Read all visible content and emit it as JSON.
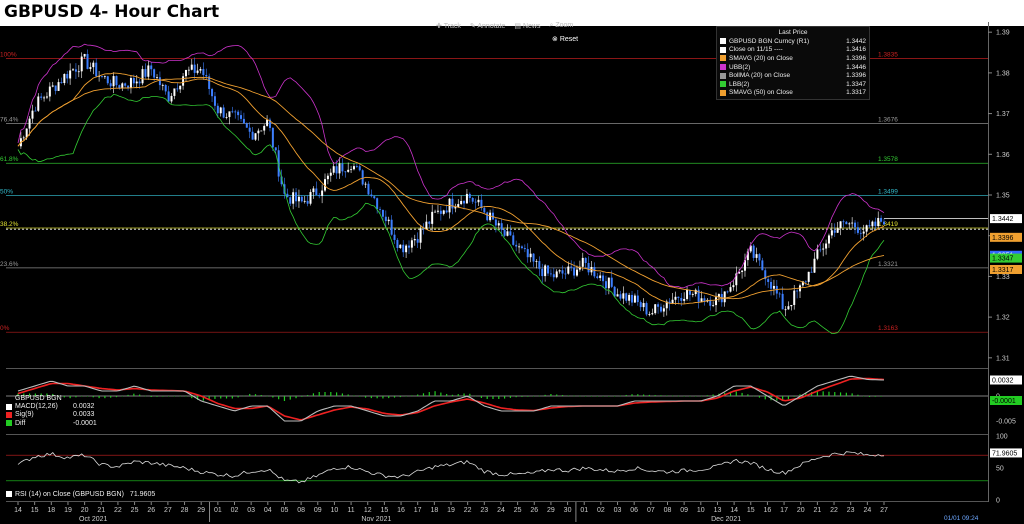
{
  "title": "GBPUSD 4- Hour Chart",
  "toolbar": {
    "track": "Track",
    "annotate": "Annotate",
    "news": "News",
    "zoom": "Zoom",
    "reset": "Reset"
  },
  "legend": {
    "header": "Last Price",
    "items": [
      {
        "label": "GBPUSD BGN Curncy  (R1)",
        "value": "1.3442",
        "color": "#ffffff"
      },
      {
        "label": "Close on 11/15  ----",
        "value": "1.3416",
        "color": "#ffffff"
      },
      {
        "label": "SMAVG (20)  on Close",
        "value": "1.3396",
        "color": "#f0a030"
      },
      {
        "label": "UBB(2)",
        "value": "1.3446",
        "color": "#cc33cc"
      },
      {
        "label": "BollMA (20)  on Close",
        "value": "1.3396",
        "color": "#999999"
      },
      {
        "label": "LBB(2)",
        "value": "1.3347",
        "color": "#33cc33"
      },
      {
        "label": "SMAVG (50)  on Close",
        "value": "1.3317",
        "color": "#f0a030"
      }
    ]
  },
  "macd_legend": {
    "title": "GBPUSD BGN",
    "items": [
      {
        "label": "MACD(12,26)",
        "value": "0.0032",
        "color": "#ffffff"
      },
      {
        "label": "Sig(9)",
        "value": "0.0033",
        "color": "#ee2222"
      },
      {
        "label": "Diff",
        "value": "-0.0001",
        "color": "#22cc22"
      }
    ]
  },
  "rsi_legend": {
    "label": "RSI (14)  on Close (GBPUSD BGN)",
    "value": "71.9605",
    "color": "#ffffff"
  },
  "timestamp": "01/01 09:24",
  "chart_data": [
    {
      "type": "candlestick",
      "title": "GBPUSD 4- Hour Chart",
      "y_ticks": [
        "1.39",
        "1.38",
        "1.37",
        "1.36",
        "1.35",
        "1.34",
        "1.33",
        "1.32",
        "1.31"
      ],
      "ylim": [
        1.3075,
        1.3925
      ],
      "x_tick_labels": [
        "14",
        "15",
        "18",
        "19",
        "20",
        "21",
        "22",
        "25",
        "26",
        "27",
        "28",
        "29",
        "01",
        "02",
        "03",
        "04",
        "05",
        "08",
        "09",
        "10",
        "11",
        "12",
        "15",
        "16",
        "17",
        "18",
        "19",
        "22",
        "23",
        "24",
        "25",
        "26",
        "29",
        "30",
        "01",
        "02",
        "03",
        "06",
        "07",
        "08",
        "09",
        "10",
        "13",
        "14",
        "15",
        "16",
        "17",
        "20",
        "21",
        "22",
        "23",
        "24",
        "27"
      ],
      "month_labels": [
        {
          "label": "Oct 2021",
          "index": 5
        },
        {
          "label": "Nov 2021",
          "index": 22
        },
        {
          "label": "Dec 2021",
          "index": 43
        }
      ],
      "fib_levels": [
        {
          "value": 1.3835,
          "left": "100%",
          "right": "1.3835",
          "color": "#cc2222"
        },
        {
          "value": 1.3676,
          "left": "76.4%",
          "right": "1.3676",
          "color": "#999999"
        },
        {
          "value": 1.3578,
          "left": "61.8%",
          "right": "1.3578",
          "color": "#33cc33"
        },
        {
          "value": 1.3499,
          "left": "50%",
          "right": "1.3499",
          "color": "#33bbcc"
        },
        {
          "value": 1.3419,
          "left": "38.2%",
          "right": "1.3419",
          "color": "#e0e030"
        },
        {
          "value": 1.3321,
          "left": "23.6%",
          "right": "1.3321",
          "color": "#999999"
        },
        {
          "value": 1.3163,
          "left": "0%",
          "right": "1.3163",
          "color": "#cc2222"
        }
      ],
      "close_line": 1.3416,
      "price_tags": [
        {
          "value": "1.3442",
          "y": 1.3442,
          "bg": "#ffffff",
          "fg": "#000000"
        },
        {
          "value": "1.3396",
          "y": 1.3396,
          "bg": "#f0a030",
          "fg": "#000000"
        },
        {
          "value": "1.3351",
          "y": 1.3352,
          "bg": "#3366ff",
          "fg": "#ffffff"
        },
        {
          "value": "1.3347",
          "y": 1.3345,
          "bg": "#33cc33",
          "fg": "#000000"
        },
        {
          "value": "1.3317",
          "y": 1.3317,
          "bg": "#f0a030",
          "fg": "#000000"
        }
      ],
      "close_path": [
        1.362,
        1.372,
        1.376,
        1.38,
        1.383,
        1.379,
        1.377,
        1.378,
        1.381,
        1.374,
        1.38,
        1.381,
        1.371,
        1.369,
        1.365,
        1.368,
        1.35,
        1.348,
        1.351,
        1.356,
        1.358,
        1.352,
        1.345,
        1.337,
        1.34,
        1.345,
        1.348,
        1.35,
        1.346,
        1.341,
        1.337,
        1.333,
        1.33,
        1.331,
        1.333,
        1.33,
        1.326,
        1.324,
        1.321,
        1.324,
        1.326,
        1.325,
        1.324,
        1.329,
        1.336,
        1.33,
        1.322,
        1.327,
        1.335,
        1.342,
        1.343,
        1.341,
        1.3442
      ]
    },
    {
      "type": "line",
      "title": "MACD",
      "y_ticks": [
        "0",
        "-0.005"
      ],
      "ylim": [
        -0.0072,
        0.0052
      ],
      "series": [
        {
          "name": "MACD(12,26)",
          "values": [
            0.001,
            0.002,
            0.003,
            0.002,
            0.002,
            0.001,
            0.001,
            0.002,
            0.001,
            0.001,
            0.001,
            -0.001,
            -0.002,
            -0.003,
            -0.002,
            -0.002,
            -0.005,
            -0.005,
            -0.003,
            -0.002,
            -0.002,
            -0.003,
            -0.004,
            -0.004,
            -0.003,
            -0.001,
            -0.001,
            0.0,
            -0.002,
            -0.003,
            -0.003,
            -0.003,
            -0.002,
            -0.002,
            -0.002,
            -0.002,
            -0.002,
            -0.001,
            -0.001,
            -0.001,
            -0.001,
            -0.001,
            0.0,
            0.002,
            0.002,
            0.0,
            -0.002,
            0.0,
            0.002,
            0.003,
            0.004,
            0.0033,
            0.0032
          ]
        },
        {
          "name": "Sig(9)",
          "values": [
            0.0005,
            0.0015,
            0.0025,
            0.0025,
            0.002,
            0.0015,
            0.0012,
            0.0015,
            0.0012,
            0.0011,
            0.001,
            0.0,
            -0.0015,
            -0.0025,
            -0.0025,
            -0.002,
            -0.004,
            -0.0048,
            -0.0038,
            -0.0028,
            -0.0022,
            -0.0026,
            -0.0035,
            -0.0038,
            -0.0033,
            -0.002,
            -0.0012,
            -0.0006,
            -0.0014,
            -0.0024,
            -0.0028,
            -0.0029,
            -0.0024,
            -0.0021,
            -0.002,
            -0.002,
            -0.002,
            -0.0014,
            -0.0012,
            -0.0011,
            -0.001,
            -0.001,
            -0.0004,
            0.001,
            0.0018,
            0.0008,
            -0.001,
            -0.0004,
            0.001,
            0.0022,
            0.0034,
            0.0035,
            0.0033
          ]
        },
        {
          "name": "Diff",
          "values": [
            0.0005,
            0.0005,
            0.0005,
            -0.0005,
            0.0,
            -0.0005,
            -0.0002,
            0.0005,
            -0.0002,
            -0.0001,
            0.0,
            -0.001,
            -0.0005,
            -0.0005,
            0.0005,
            0.0,
            -0.001,
            -0.0002,
            0.0008,
            0.0008,
            0.0002,
            -0.0004,
            -0.0005,
            -0.0002,
            0.0003,
            0.001,
            0.0002,
            0.0006,
            -0.0006,
            -0.0006,
            -0.0002,
            -0.0001,
            0.0004,
            0.0001,
            0.0,
            0.0,
            0.0,
            0.0004,
            0.0002,
            0.0001,
            0.0,
            0.0,
            0.0004,
            0.001,
            0.0002,
            -0.0008,
            -0.001,
            0.0004,
            0.001,
            0.0008,
            0.0006,
            -0.0002,
            -0.0001
          ]
        }
      ],
      "tags": [
        {
          "value": "0.0032",
          "y": 0.0032,
          "bg": "#ffffff",
          "fg": "#000000"
        },
        {
          "value": "-0.0001",
          "y": -0.0001,
          "bg": "#22cc22",
          "fg": "#000000"
        }
      ]
    },
    {
      "type": "line",
      "title": "RSI",
      "y_ticks": [
        "100",
        "50",
        "0"
      ],
      "ylim": [
        0,
        100
      ],
      "bands": [
        70,
        30
      ],
      "series": [
        {
          "name": "RSI (14)",
          "values": [
            55,
            68,
            72,
            66,
            70,
            55,
            52,
            60,
            58,
            54,
            50,
            44,
            40,
            38,
            45,
            48,
            30,
            28,
            38,
            50,
            52,
            44,
            38,
            36,
            44,
            52,
            55,
            60,
            45,
            40,
            40,
            42,
            48,
            46,
            50,
            47,
            45,
            50,
            46,
            44,
            46,
            48,
            52,
            62,
            58,
            48,
            42,
            55,
            66,
            72,
            74,
            70,
            71.96
          ]
        }
      ],
      "tags": [
        {
          "value": "71.9605",
          "y": 71.96,
          "bg": "#ffffff",
          "fg": "#000000"
        }
      ]
    }
  ]
}
